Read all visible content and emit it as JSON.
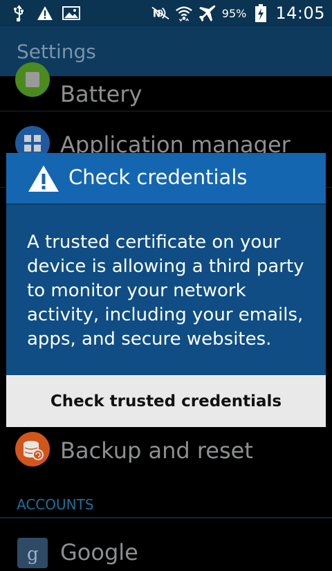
{
  "status_bar": {
    "icons_left": [
      "usb-icon",
      "warning-icon",
      "image-icon"
    ],
    "icons_right": [
      "nfc-icon",
      "wifi-icon",
      "airplane-icon",
      "battery-charging-icon"
    ],
    "battery_percent": "95%",
    "time": "14:05"
  },
  "action_bar": {
    "title": "Settings"
  },
  "settings_list": {
    "items": [
      {
        "label": "Battery",
        "icon": "battery-icon",
        "icon_color": "#4a8a1e"
      },
      {
        "label": "Application manager",
        "icon": "apps-grid-icon",
        "icon_color": "#1f5aa0"
      },
      {
        "label": "Backup and reset",
        "icon": "backup-icon",
        "icon_color": "#d2551a"
      }
    ],
    "section_header": "ACCOUNTS",
    "account_item": {
      "label": "Google",
      "icon": "google-icon",
      "icon_color": "#2f4a66"
    }
  },
  "dialog": {
    "title": "Check credentials",
    "icon": "warning-icon",
    "message": "A trusted certificate on your device is allowing a third party to monitor your network activity, including your emails, apps, and secure websites.",
    "button_label": "Check trusted credentials"
  },
  "colors": {
    "status_bar_bg": "#0b3352",
    "action_bar_bg": "#0e3a5e",
    "dialog_header_bg": "#1466b0",
    "dialog_body_bg": "#0f4d84",
    "button_bg": "#e9e9e9",
    "section_header_color": "#1e6f9c"
  }
}
